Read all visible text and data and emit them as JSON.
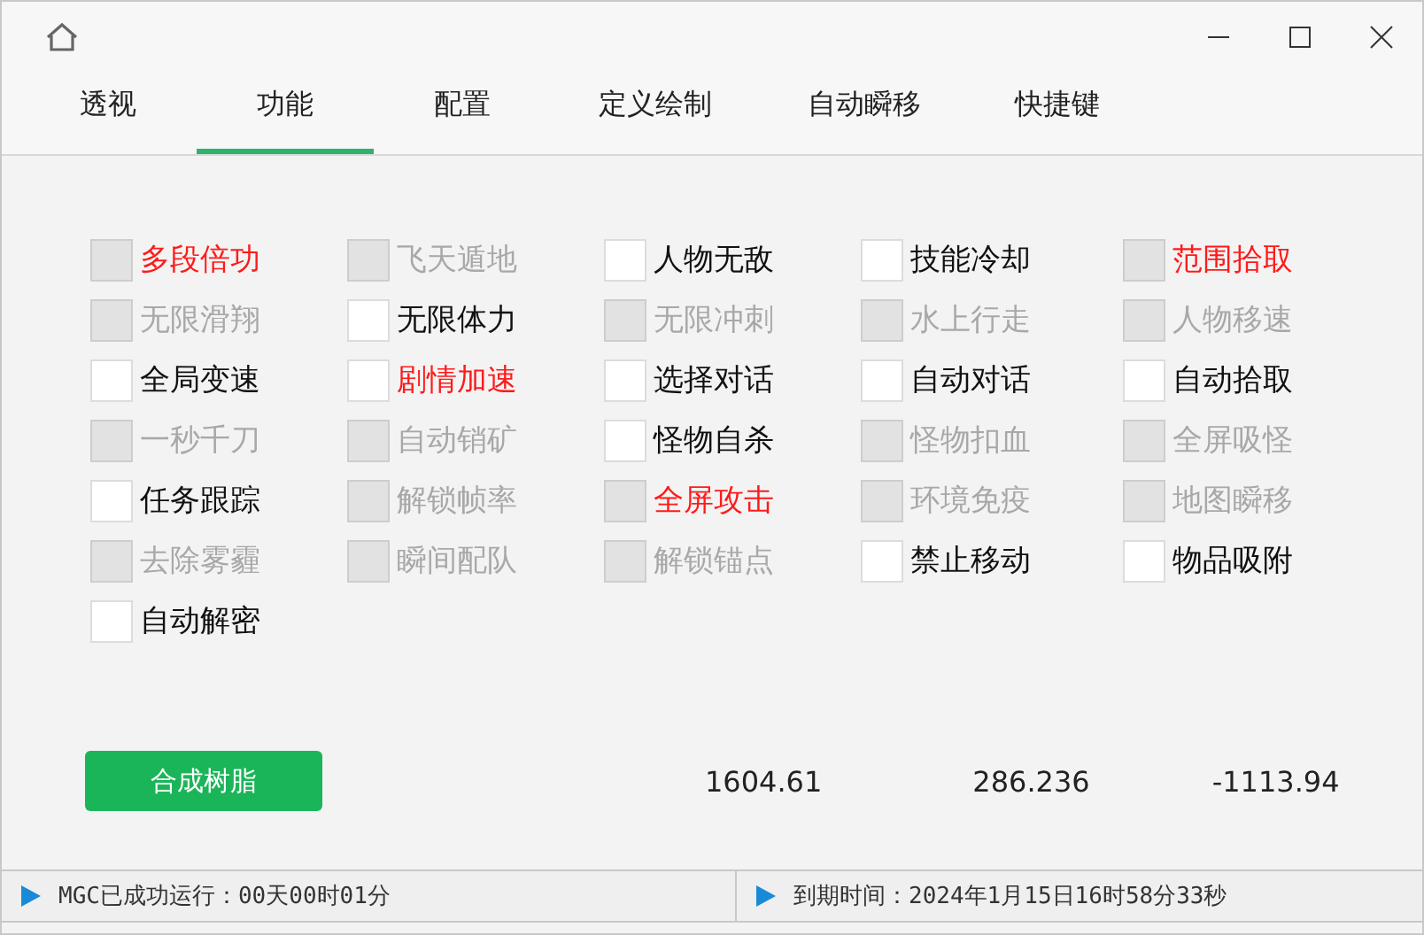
{
  "tabs": [
    {
      "label": "透视",
      "selected": false
    },
    {
      "label": "功能",
      "selected": true
    },
    {
      "label": "配置",
      "selected": false
    },
    {
      "label": "定义绘制",
      "selected": false
    },
    {
      "label": "自动瞬移",
      "selected": false
    },
    {
      "label": "快捷键",
      "selected": false
    }
  ],
  "columns": [
    [
      {
        "label": "多段倍功",
        "disabled": true,
        "highlighted": true
      },
      {
        "label": "无限滑翔",
        "disabled": true,
        "highlighted": false
      },
      {
        "label": "全局变速",
        "disabled": false,
        "highlighted": false
      },
      {
        "label": "一秒千刀",
        "disabled": true,
        "highlighted": false
      },
      {
        "label": "任务跟踪",
        "disabled": false,
        "highlighted": false
      },
      {
        "label": "去除雾霾",
        "disabled": true,
        "highlighted": false
      },
      {
        "label": "自动解密",
        "disabled": false,
        "highlighted": false
      }
    ],
    [
      {
        "label": "飞天遁地",
        "disabled": true,
        "highlighted": false
      },
      {
        "label": "无限体力",
        "disabled": false,
        "highlighted": false
      },
      {
        "label": "剧情加速",
        "disabled": false,
        "highlighted": true
      },
      {
        "label": "自动销矿",
        "disabled": true,
        "highlighted": false
      },
      {
        "label": "解锁帧率",
        "disabled": true,
        "highlighted": false
      },
      {
        "label": "瞬间配队",
        "disabled": true,
        "highlighted": false
      }
    ],
    [
      {
        "label": "人物无敌",
        "disabled": false,
        "highlighted": false
      },
      {
        "label": "无限冲刺",
        "disabled": true,
        "highlighted": false
      },
      {
        "label": "选择对话",
        "disabled": false,
        "highlighted": false
      },
      {
        "label": "怪物自杀",
        "disabled": false,
        "highlighted": false
      },
      {
        "label": "全屏攻击",
        "disabled": true,
        "highlighted": true
      },
      {
        "label": "解锁锚点",
        "disabled": true,
        "highlighted": false
      }
    ],
    [
      {
        "label": "技能冷却",
        "disabled": false,
        "highlighted": false
      },
      {
        "label": "水上行走",
        "disabled": true,
        "highlighted": false
      },
      {
        "label": "自动对话",
        "disabled": false,
        "highlighted": false
      },
      {
        "label": "怪物扣血",
        "disabled": true,
        "highlighted": false
      },
      {
        "label": "环境免疫",
        "disabled": true,
        "highlighted": false
      },
      {
        "label": "禁止移动",
        "disabled": false,
        "highlighted": false
      }
    ],
    [
      {
        "label": "范围拾取",
        "disabled": true,
        "highlighted": true
      },
      {
        "label": "人物移速",
        "disabled": true,
        "highlighted": false
      },
      {
        "label": "自动拾取",
        "disabled": false,
        "highlighted": false
      },
      {
        "label": "全屏吸怪",
        "disabled": true,
        "highlighted": false
      },
      {
        "label": "地图瞬移",
        "disabled": true,
        "highlighted": false
      },
      {
        "label": "物品吸附",
        "disabled": false,
        "highlighted": false
      }
    ]
  ],
  "action_button": "合成树脂",
  "readings": [
    "1604.61",
    "286.236",
    "-1113.94"
  ],
  "status_bar": [
    "MGC已成功运行：00天00时01分",
    "到期时间：2024年1月15日16时58分33秒"
  ]
}
